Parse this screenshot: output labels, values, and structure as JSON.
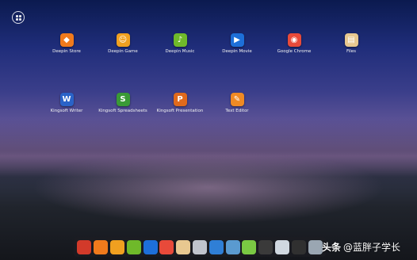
{
  "launcher": {
    "apps": [
      {
        "label": "Deepin Store",
        "icon": "store-icon",
        "color": "#f07a1c",
        "glyph": "◆"
      },
      {
        "label": "Deepin Game",
        "icon": "game-icon",
        "color": "#f0a020",
        "glyph": "☺"
      },
      {
        "label": "Deepin Music",
        "icon": "music-icon",
        "color": "#6fb92a",
        "glyph": "♪"
      },
      {
        "label": "Deepin Movie",
        "icon": "movie-icon",
        "color": "#1d6fd9",
        "glyph": "▶"
      },
      {
        "label": "Google Chrome",
        "icon": "chrome-icon",
        "color": "#e84a3a",
        "glyph": "◉"
      },
      {
        "label": "Files",
        "icon": "files-icon",
        "color": "#e8c890",
        "glyph": "▤"
      },
      {
        "label": "Kingsoft Writer",
        "icon": "writer-icon",
        "color": "#2a63c8",
        "glyph": "W"
      },
      {
        "label": "Kingsoft Spreadsheets",
        "icon": "spreadsheets-icon",
        "color": "#3a9a36",
        "glyph": "S"
      },
      {
        "label": "Kingsoft Presentation",
        "icon": "presentation-icon",
        "color": "#e06a1c",
        "glyph": "P"
      },
      {
        "label": "Text Editor",
        "icon": "text-editor-icon",
        "color": "#f08a24",
        "glyph": "✎"
      }
    ]
  },
  "dock": {
    "items": [
      {
        "icon": "rocket-launcher-icon",
        "color": "#d23a2a"
      },
      {
        "icon": "store-icon",
        "color": "#f07a1c"
      },
      {
        "icon": "game-icon",
        "color": "#f0a020"
      },
      {
        "icon": "music-icon",
        "color": "#6fb92a"
      },
      {
        "icon": "movie-icon",
        "color": "#1d6fd9"
      },
      {
        "icon": "chrome-icon",
        "color": "#e84a3a"
      },
      {
        "icon": "files-icon",
        "color": "#e8c890"
      },
      {
        "icon": "settings-icon",
        "color": "#c0c4cc"
      },
      {
        "icon": "network-icon",
        "color": "#2f7fd6"
      },
      {
        "icon": "disk-icon",
        "color": "#5a9ad0"
      },
      {
        "icon": "terminal-icon",
        "color": "#7ac943"
      },
      {
        "icon": "camera-icon",
        "color": "#3a3a3a"
      },
      {
        "icon": "document-icon",
        "color": "#d0d8e0"
      },
      {
        "icon": "screenshot-icon",
        "color": "#303030"
      },
      {
        "icon": "trash-icon",
        "color": "#9aa6b2"
      }
    ]
  },
  "watermark": {
    "source": "头条",
    "author": "@蓝胖子学长"
  }
}
